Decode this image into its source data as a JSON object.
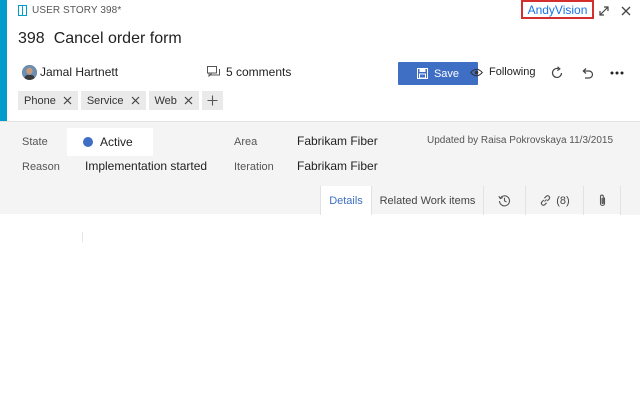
{
  "workitem": {
    "type_label": "USER STORY 398*",
    "id": "398",
    "title": "Cancel order form"
  },
  "brand": "AndyVision",
  "assignee": {
    "name": "Jamal Hartnett"
  },
  "comments": {
    "label": "5 comments"
  },
  "toolbar": {
    "save_label": "Save",
    "following_label": "Following"
  },
  "tags": [
    "Phone",
    "Service",
    "Web"
  ],
  "fields": {
    "state_label": "State",
    "state_value": "Active",
    "reason_label": "Reason",
    "reason_value": "Implementation started",
    "area_label": "Area",
    "area_value": "Fabrikam Fiber",
    "iteration_label": "Iteration",
    "iteration_value": "Fabrikam Fiber",
    "updated_text": "Updated by Raisa Pokrovskaya 11/3/2015"
  },
  "tabs": {
    "details": "Details",
    "related": "Related Work items",
    "links_count": "(8)"
  },
  "colors": {
    "accent_bar": "#009ccc",
    "save_button": "#3e6fc4",
    "active_state": "#3e6fc4",
    "brand_border": "#d32f2f"
  }
}
